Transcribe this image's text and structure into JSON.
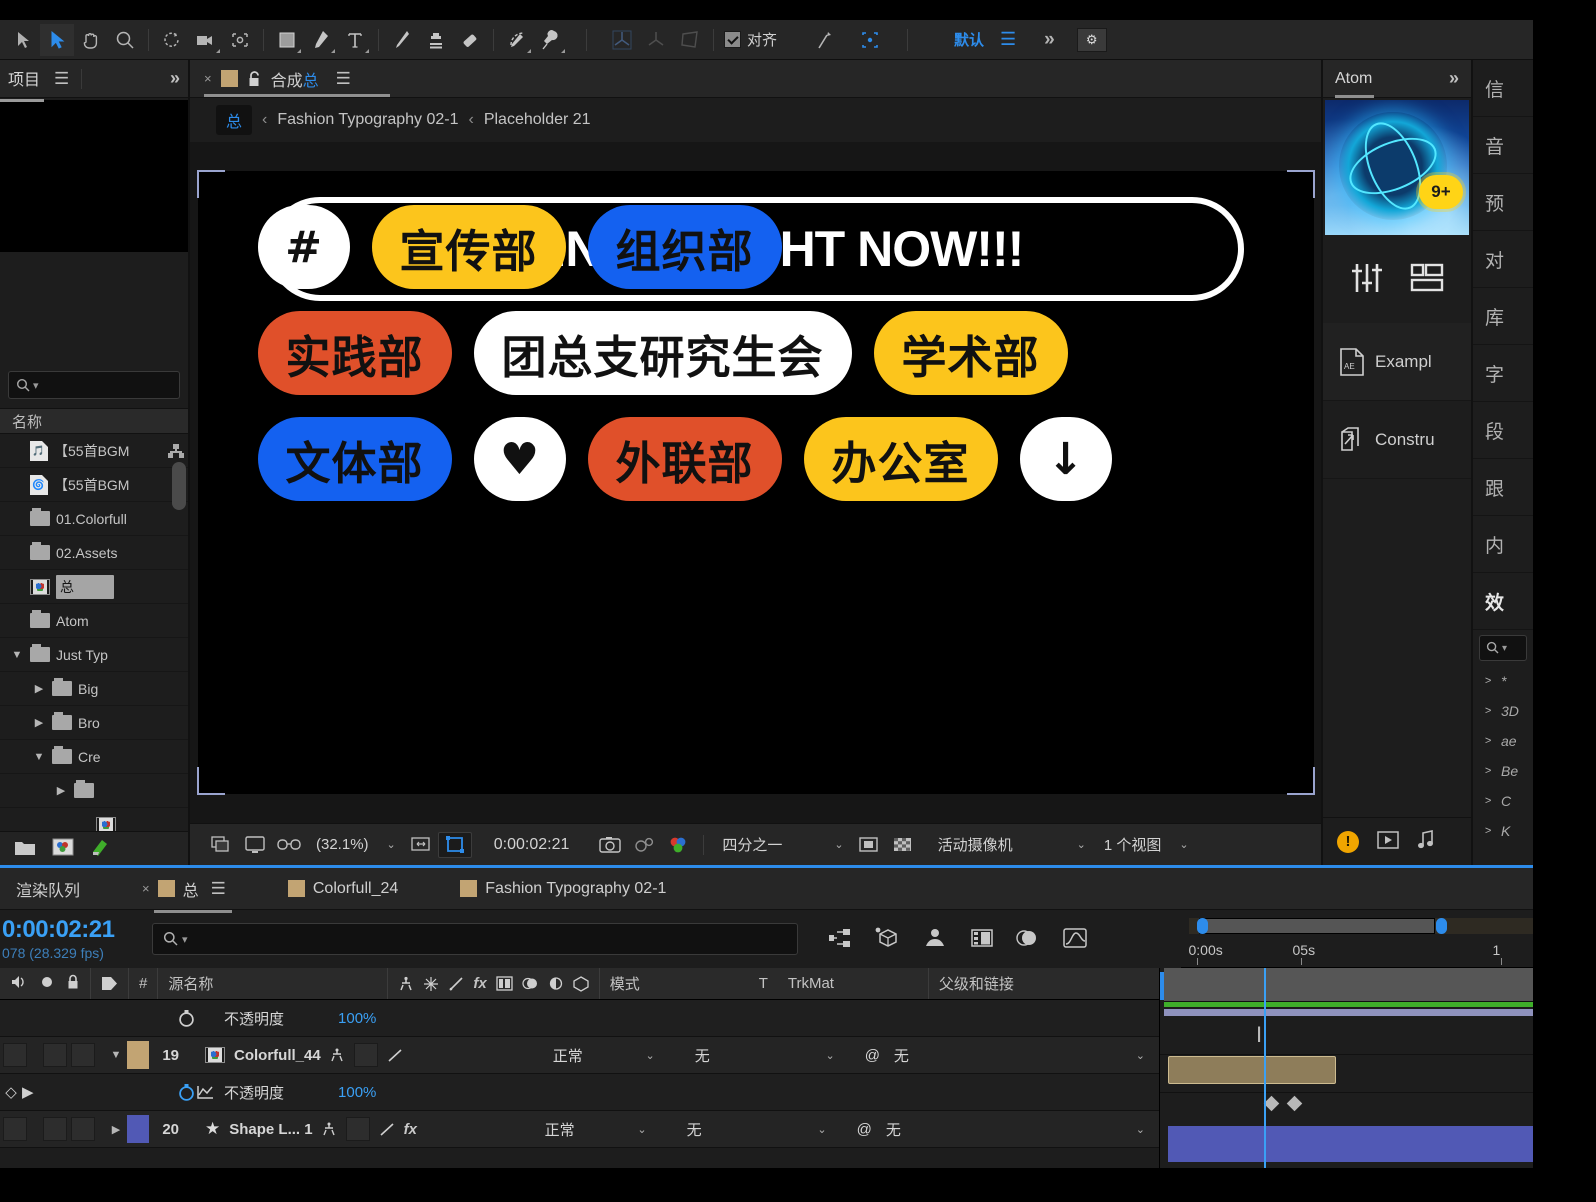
{
  "toolbar": {
    "align_label": "对齐",
    "workspace": "默认",
    "tools": [
      {
        "name": "home-tool"
      },
      {
        "name": "selection-tool"
      },
      {
        "name": "hand-tool"
      },
      {
        "name": "zoom-tool"
      },
      {
        "name": "rotation-tool"
      },
      {
        "name": "camera-tool"
      },
      {
        "name": "anchor-point-tool"
      },
      {
        "name": "shape-tool"
      },
      {
        "name": "pen-tool"
      },
      {
        "name": "type-tool"
      },
      {
        "name": "brush-tool"
      },
      {
        "name": "clone-stamp-tool"
      },
      {
        "name": "eraser-tool"
      },
      {
        "name": "roto-brush-tool"
      },
      {
        "name": "puppet-pin-tool"
      }
    ]
  },
  "project_panel": {
    "tab_label": "项目",
    "search_placeholder": "",
    "column_header": "名称",
    "items": [
      {
        "label": "【55首BGM",
        "icon": "audio-file-icon",
        "depth": 0,
        "expander": "",
        "selected": false,
        "shortcut": true
      },
      {
        "label": "【55首BGM",
        "icon": "video-file-icon",
        "depth": 0,
        "expander": "",
        "selected": false,
        "shortcut": false
      },
      {
        "label": "01.Colorfull",
        "icon": "folder-icon",
        "depth": 0,
        "expander": "",
        "selected": false,
        "shortcut": false
      },
      {
        "label": "02.Assets",
        "icon": "folder-icon",
        "depth": 0,
        "expander": "",
        "selected": false,
        "shortcut": false
      },
      {
        "label": "总",
        "icon": "composition-icon",
        "depth": 0,
        "expander": "",
        "selected": true,
        "shortcut": false
      },
      {
        "label": "Atom",
        "icon": "folder-icon",
        "depth": 0,
        "expander": "",
        "selected": false,
        "shortcut": false
      },
      {
        "label": "Just Typ",
        "icon": "folder-icon",
        "depth": 0,
        "expander": "▼",
        "selected": false,
        "shortcut": false
      },
      {
        "label": "Big",
        "icon": "folder-icon",
        "depth": 1,
        "expander": "▶",
        "selected": false,
        "shortcut": false
      },
      {
        "label": "Bro",
        "icon": "folder-icon",
        "depth": 1,
        "expander": "▶",
        "selected": false,
        "shortcut": false
      },
      {
        "label": "Cre",
        "icon": "folder-icon",
        "depth": 1,
        "expander": "▼",
        "selected": false,
        "shortcut": false
      },
      {
        "label": "",
        "icon": "folder-icon",
        "depth": 2,
        "expander": "▶",
        "selected": false,
        "shortcut": false
      },
      {
        "label": "",
        "icon": "composition-icon",
        "depth": 3,
        "expander": "",
        "selected": false,
        "shortcut": false
      }
    ]
  },
  "composition_panel": {
    "tab_prefix": "合成",
    "tab_name": "总",
    "breadcrumb": {
      "chip": "总",
      "items": [
        "Fashion Typography 02-1",
        "Placeholder 21"
      ],
      "separator": "‹"
    },
    "viewer_bar": {
      "zoom": "(32.1%)",
      "time": "0:00:02:21",
      "resolution": "四分之一",
      "camera": "活动摄像机",
      "views": "1 个视图"
    }
  },
  "canvas": {
    "rows": [
      [
        {
          "text": "#",
          "bg": "#ffffff",
          "fg": "#111111",
          "shape": "circle"
        },
        {
          "text": "宣传部",
          "bg": "#fcc51c",
          "fg": "#111111",
          "shape": "pill"
        },
        {
          "text": "组织部",
          "bg": "#1461f0",
          "fg": "#111111",
          "shape": "pill"
        }
      ],
      [
        {
          "text": "实践部",
          "bg": "#e0502a",
          "fg": "#111111",
          "shape": "pill"
        },
        {
          "text": "团总支研究生会",
          "bg": "#ffffff",
          "fg": "#111111",
          "shape": "pill"
        },
        {
          "text": "学术部",
          "bg": "#fcc51c",
          "fg": "#111111",
          "shape": "pill"
        }
      ],
      [
        {
          "text": "文体部",
          "bg": "#1461f0",
          "fg": "#111111",
          "shape": "pill"
        },
        {
          "text": "♥",
          "bg": "#ffffff",
          "fg": "#111111",
          "shape": "circle"
        },
        {
          "text": "外联部",
          "bg": "#e0502a",
          "fg": "#111111",
          "shape": "pill"
        },
        {
          "text": "办公室",
          "bg": "#fcc51c",
          "fg": "#111111",
          "shape": "pill"
        },
        {
          "text": "↓",
          "bg": "#ffffff",
          "fg": "#111111",
          "shape": "circle"
        }
      ]
    ],
    "cta": "JOIN US RIGHT NOW!!!"
  },
  "atom_panel": {
    "tab_label": "Atom",
    "badge": "9+",
    "items": [
      {
        "label": "Exampl",
        "icon": "ae-file-icon"
      },
      {
        "label": "Constru",
        "icon": "export-icon"
      }
    ]
  },
  "vertical_tabs": {
    "labels": [
      "信",
      "音",
      "预",
      "对",
      "库",
      "字",
      "段",
      "跟",
      "内",
      "效"
    ],
    "bold_index": 9,
    "effects_items": [
      "*",
      "3D",
      "ae",
      "Be",
      "C",
      "K"
    ]
  },
  "timeline": {
    "tabs": [
      {
        "label": "渲染队列",
        "active": false,
        "swatch": false
      },
      {
        "label": "总",
        "active": true,
        "swatch": true
      },
      {
        "label": "Colorfull_24",
        "active": false,
        "swatch": true
      },
      {
        "label": "Fashion Typography 02-1",
        "active": false,
        "swatch": true
      }
    ],
    "timecode": "0:00:02:21",
    "frame_info": "078 (28.329 fps)",
    "search_placeholder": "",
    "columns": {
      "num": "#",
      "source_name": "源名称",
      "mode": "模式",
      "t": "T",
      "trkmat": "TrkMat",
      "parent": "父级和链接"
    },
    "ruler_labels": [
      "0:00s",
      "05s",
      "1"
    ],
    "layers": [
      {
        "type": "prop",
        "name": "不透明度",
        "value": "100%",
        "stopwatch": false,
        "graph": false
      },
      {
        "type": "layer",
        "index": "19",
        "name": "Colorfull_44",
        "icon": "composition-icon",
        "color": "#c2a473",
        "mode": "正常",
        "trkmat": "无",
        "parent": "无",
        "expander": "▼"
      },
      {
        "type": "prop",
        "name": "不透明度",
        "value": "100%",
        "stopwatch": true,
        "graph": true
      },
      {
        "type": "layer",
        "index": "20",
        "name": "Shape L... 1",
        "icon": "star-icon",
        "color": "#5159b5",
        "mode": "正常",
        "trkmat": "无",
        "parent": "无",
        "expander": "▶"
      }
    ]
  }
}
